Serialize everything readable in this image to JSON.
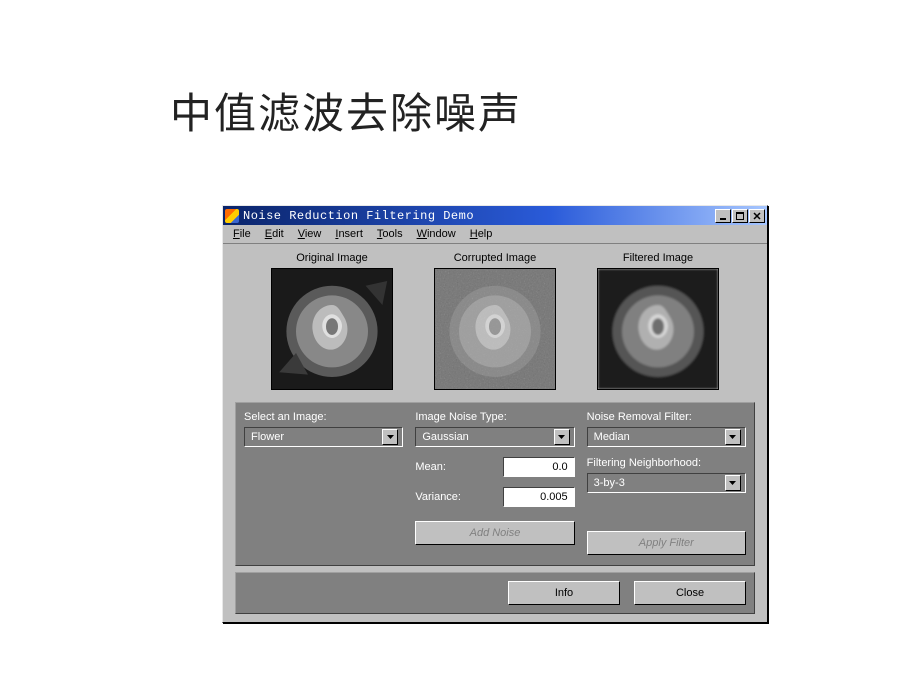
{
  "page": {
    "title": "中值滤波去除噪声"
  },
  "window": {
    "title": "Noise Reduction Filtering Demo"
  },
  "menu": {
    "file": "File",
    "edit": "Edit",
    "view": "View",
    "insert": "Insert",
    "tools": "Tools",
    "window": "Window",
    "help": "Help"
  },
  "images": {
    "original": "Original Image",
    "corrupted": "Corrupted Image",
    "filtered": "Filtered Image"
  },
  "controls": {
    "select_image_label": "Select an Image:",
    "select_image_value": "Flower",
    "noise_type_label": "Image Noise Type:",
    "noise_type_value": "Gaussian",
    "filter_label": "Noise Removal Filter:",
    "filter_value": "Median",
    "mean_label": "Mean:",
    "mean_value": "0.0",
    "variance_label": "Variance:",
    "variance_value": "0.005",
    "neighborhood_label": "Filtering Neighborhood:",
    "neighborhood_value": "3-by-3",
    "add_noise_btn": "Add Noise",
    "apply_filter_btn": "Apply Filter",
    "info_btn": "Info",
    "close_btn": "Close"
  }
}
